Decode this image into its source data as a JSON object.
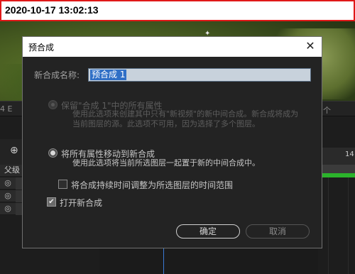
{
  "timestamp": "2020-10-17 13:02:13",
  "dialog": {
    "title": "预合成",
    "close_symbol": "✕",
    "name_label": "新合成名称:",
    "name_value": "预合成 1",
    "option1_label": "保留\"合成 1\"中的所有属性",
    "option1_desc": "使用此选项来创建其中只有\"新视频\"的新中间合成。新合成将成为当前图层的源。此选项不可用，因为选择了多个图层。",
    "option2_label": "将所有属性移动到新合成",
    "option2_desc": "使用此选项将当前所选图层一起置于新的中间合成中。",
    "adjust_duration_label": "将合成持续时间调整为所选图层的时间范围",
    "open_comp_label": "打开新合成",
    "ok_label": "确定",
    "cancel_label": "取消"
  },
  "background": {
    "strip_left_text": "4 E",
    "strip_right_text": "个",
    "column_header": "父级",
    "ruler_label": "14",
    "parent_pick_whip_glyph": "◎"
  },
  "icons": {
    "close": "close-icon",
    "anchor": "anchor-point-icon",
    "layer_tool": "layer-tool-icon",
    "pick_whip": "pick-whip-icon",
    "checkbox_checked": "checkmark-icon"
  },
  "colors": {
    "highlight": "#2f6fc6",
    "timeline_green": "#2bb32b",
    "timestamp_border": "#e01818"
  }
}
